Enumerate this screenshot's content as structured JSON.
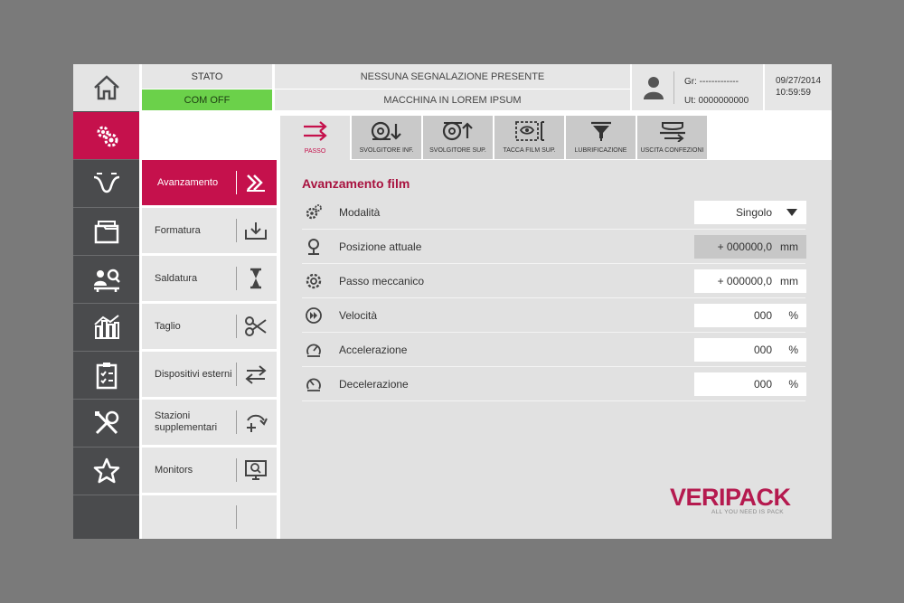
{
  "header": {
    "stato_label": "STATO",
    "com_status": "COM OFF",
    "message_1": "NESSUNA SEGNALAZIONE PRESENTE",
    "message_2": "MACCHINA IN LOREM IPSUM",
    "user_group": "Gr: -------------",
    "user_id": "Ut: 0000000000",
    "date": "09/27/2014",
    "time": "10:59:59"
  },
  "rail": {
    "items": [
      {
        "icon": "home-icon"
      },
      {
        "icon": "settings-gears-icon",
        "active": true
      },
      {
        "icon": "film-feed-icon"
      },
      {
        "icon": "folder-icon"
      },
      {
        "icon": "operator-inspection-icon"
      },
      {
        "icon": "statistics-chart-icon"
      },
      {
        "icon": "checklist-icon"
      },
      {
        "icon": "tools-icon"
      },
      {
        "icon": "star-icon"
      }
    ]
  },
  "submenu": {
    "items": [
      {
        "label": "Avanzamento",
        "icon": "double-arrow-icon",
        "active": true
      },
      {
        "label": "Formatura",
        "icon": "tray-download-icon"
      },
      {
        "label": "Saldatura",
        "icon": "hourglass-icon"
      },
      {
        "label": "Taglio",
        "icon": "scissors-icon"
      },
      {
        "label": "Dispositivi esterni",
        "icon": "swap-arrows-icon"
      },
      {
        "label": "Stazioni supplementari",
        "icon": "add-station-icon"
      },
      {
        "label": "Monitors",
        "icon": "monitor-icon"
      },
      {
        "label": "",
        "icon": ""
      }
    ]
  },
  "tabs": [
    {
      "label": "PASSO",
      "icon": "step-arrows-icon",
      "active": true
    },
    {
      "label": "SVOLGITORE INF.",
      "icon": "unwinder-lower-icon"
    },
    {
      "label": "SVOLGITORE SUP.",
      "icon": "unwinder-upper-icon"
    },
    {
      "label": "TACCA FILM SUP.",
      "icon": "film-mark-icon"
    },
    {
      "label": "LUBRIFICAZIONE",
      "icon": "lubrication-icon"
    },
    {
      "label": "USCITA CONFEZIONI",
      "icon": "package-exit-icon"
    }
  ],
  "section": {
    "title": "Avanzamento film",
    "rows": [
      {
        "label": "Modalità",
        "value": "Singolo",
        "unit": "",
        "type": "dropdown"
      },
      {
        "label": "Posizione attuale",
        "value": "+ 000000,0",
        "unit": "mm",
        "type": "readonly"
      },
      {
        "label": "Passo meccanico",
        "value": "+ 000000,0",
        "unit": "mm",
        "type": "input"
      },
      {
        "label": "Velocità",
        "value": "000",
        "unit": "%",
        "type": "input"
      },
      {
        "label": "Accelerazione",
        "value": "000",
        "unit": "%",
        "type": "input"
      },
      {
        "label": "Decelerazione",
        "value": "000",
        "unit": "%",
        "type": "input"
      }
    ]
  },
  "logo": {
    "name": "VERIPACK",
    "tagline": "ALL YOU NEED IS PACK"
  },
  "colors": {
    "accent": "#c5114c",
    "status_ok": "#6bd14a",
    "rail": "#4a4b4d"
  }
}
